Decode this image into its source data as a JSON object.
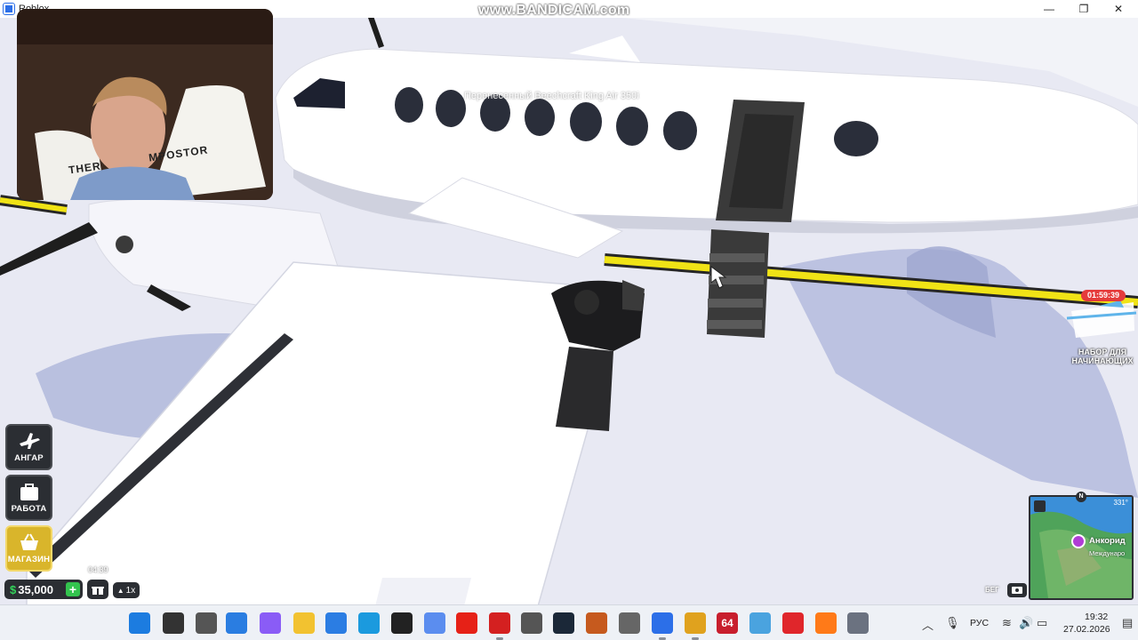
{
  "window": {
    "title": "Roblox",
    "minimize_glyph": "—",
    "maximize_glyph": "❐",
    "close_glyph": "✕"
  },
  "watermark": "www.BANDICAM.com",
  "webcam": {
    "pillow_text_line1": "THER",
    "pillow_text_line2": "MPOSTOR"
  },
  "game": {
    "plane_label": "Перенесенный Beechcraft King Air 350i",
    "left_menu": [
      {
        "label": "АНГАР",
        "icon": "plane-icon"
      },
      {
        "label": "РАБОТА",
        "icon": "briefcase-icon"
      },
      {
        "label": "МАГАЗИН",
        "icon": "basket-icon"
      }
    ],
    "money": "35,000",
    "money_symbol": "$",
    "add_money_glyph": "+",
    "gift_timer": "04:39",
    "speed": "1x",
    "offer": {
      "timer": "01:59:39",
      "label_line1": "НАБОР ДЛЯ",
      "label_line2": "НАЧИНАЮЩИХ"
    },
    "minimap": {
      "north": "N",
      "heading": "331°",
      "city": "Анкорид",
      "airport": "Междунаро"
    },
    "run_label": "БЕГ"
  },
  "taskbar": {
    "apps": [
      {
        "name": "start-button",
        "icon": "windows-icon",
        "color": "#1c7ce0"
      },
      {
        "name": "search-button",
        "icon": "search-icon",
        "color": "#333333"
      },
      {
        "name": "task-view-button",
        "icon": "task-view-icon",
        "color": "#555555"
      },
      {
        "name": "media-app",
        "icon": "play-icon",
        "color": "#2a7de1"
      },
      {
        "name": "copilot-app",
        "icon": "copilot-icon",
        "color": "#8a5cf6"
      },
      {
        "name": "file-explorer",
        "icon": "folder-icon",
        "color": "#f2c230"
      },
      {
        "name": "store-app",
        "icon": "store-icon",
        "color": "#2b7de3"
      },
      {
        "name": "edge-browser",
        "icon": "edge-icon",
        "color": "#1b9ade"
      },
      {
        "name": "roblox-studio",
        "icon": "roblox-icon",
        "color": "#222222"
      },
      {
        "name": "g-app",
        "icon": "g-icon",
        "color": "#5b8def"
      },
      {
        "name": "youtube-app",
        "icon": "youtube-icon",
        "color": "#e62117"
      },
      {
        "name": "bandicam-app",
        "icon": "record-icon",
        "color": "#d42020"
      },
      {
        "name": "game-app",
        "icon": "game-icon",
        "color": "#555555"
      },
      {
        "name": "steam-app",
        "icon": "steam-icon",
        "color": "#1b2838"
      },
      {
        "name": "basketball-app",
        "icon": "ball-icon",
        "color": "#c65a1e"
      },
      {
        "name": "camera-app",
        "icon": "camera-icon",
        "color": "#666666"
      },
      {
        "name": "roblox-app",
        "icon": "roblox-icon",
        "color": "#2c6fe8"
      },
      {
        "name": "chrome-browser",
        "icon": "chrome-icon",
        "color": "#e0a21e"
      },
      {
        "name": "app-64",
        "icon": "64-icon",
        "color": "#c81e2d",
        "text": "64"
      },
      {
        "name": "photo-app",
        "icon": "photo-icon",
        "color": "#4aa3df"
      },
      {
        "name": "opera-browser",
        "icon": "opera-icon",
        "color": "#e0262b"
      },
      {
        "name": "firefox-browser",
        "icon": "firefox-icon",
        "color": "#ff7a18"
      },
      {
        "name": "settings-app",
        "icon": "gear-icon",
        "color": "#6b7280"
      }
    ],
    "language": "РУС",
    "time": "19:32",
    "date": "27.02.2026"
  }
}
